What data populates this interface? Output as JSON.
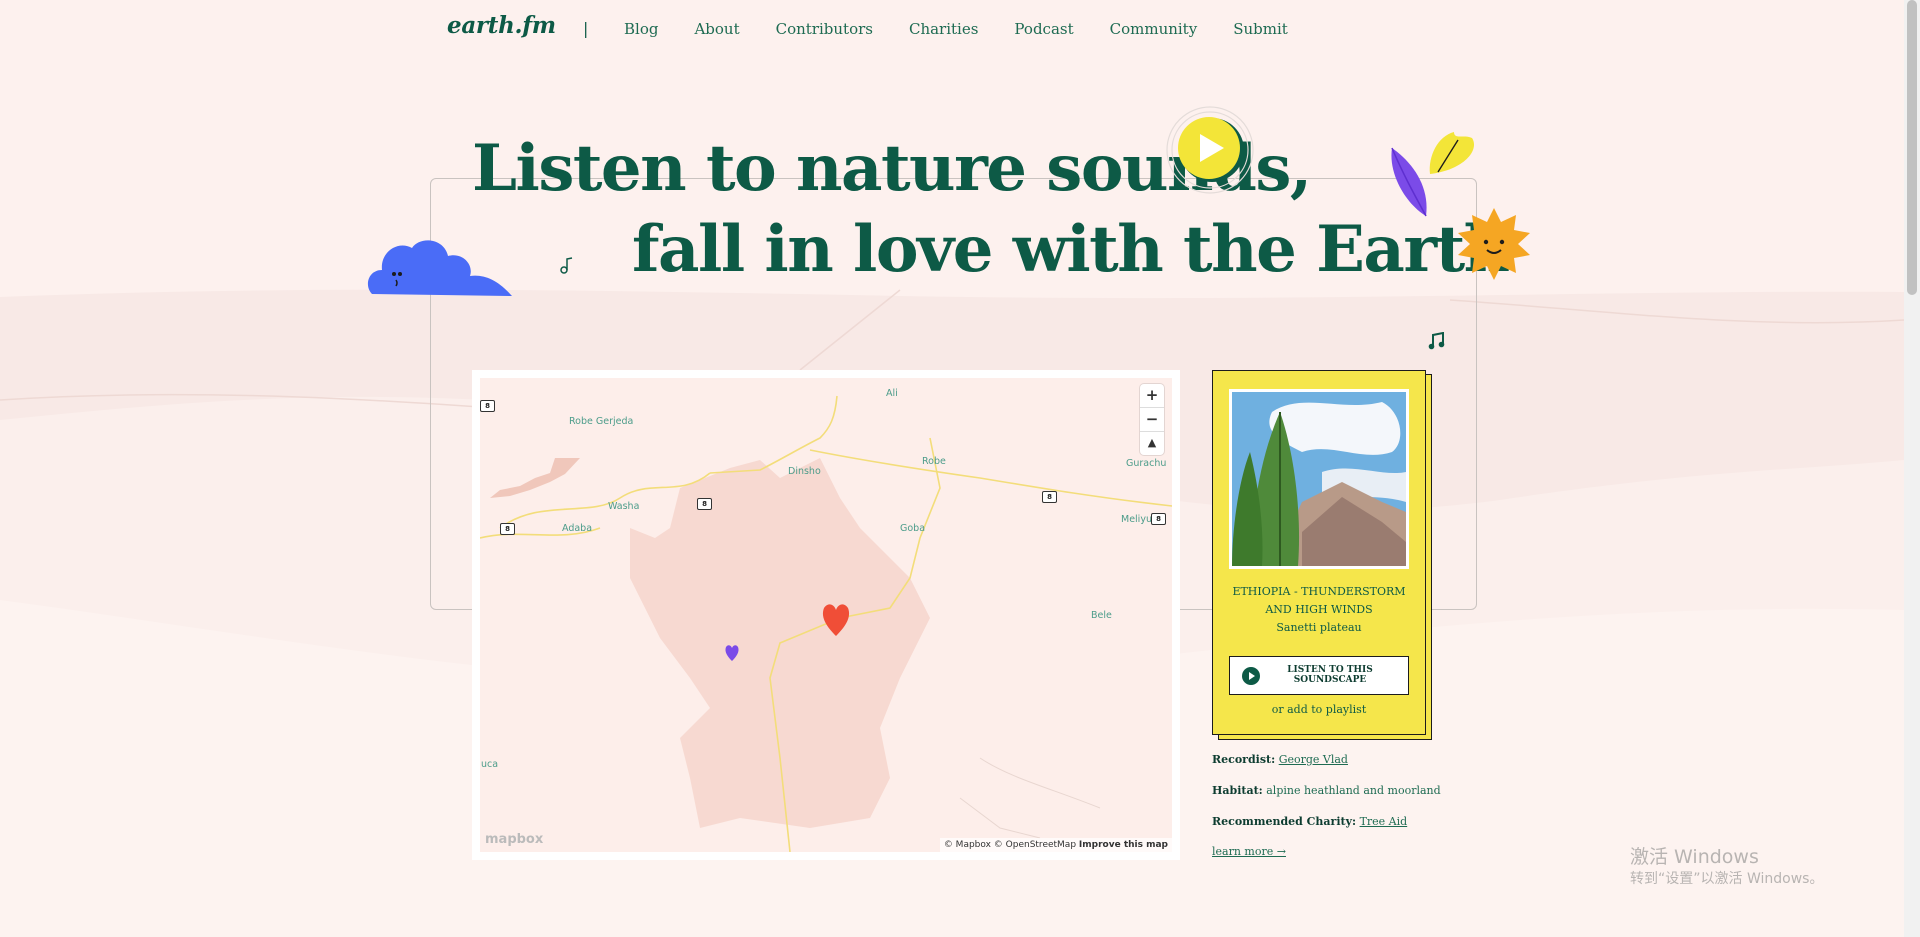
{
  "nav": {
    "logo": "earth.fm",
    "separator": "|",
    "links": [
      "Blog",
      "About",
      "Contributors",
      "Charities",
      "Podcast",
      "Community",
      "Submit"
    ]
  },
  "hero": {
    "line1": "Listen to nature sounds,",
    "line2": "fall in love with the Earth"
  },
  "map": {
    "zoom_in": "+",
    "zoom_out": "−",
    "compass": "▲",
    "towns": [
      "Robe Gerjeda",
      "Ali",
      "Dinsho",
      "Robe",
      "Gurachu",
      "Washa",
      "Adaba",
      "Goba",
      "Meliyu",
      "Bele",
      "uca"
    ],
    "road_shield": "8",
    "mapbox_logo": "mapbox",
    "attribution": "© Mapbox © OpenStreetMap",
    "improve_link": "Improve this map"
  },
  "soundscape": {
    "title": "ETHIOPIA - THUNDERSTORM AND HIGH WINDS",
    "location": "Sanetti plateau",
    "listen_button": "LISTEN TO THIS SOUNDSCAPE",
    "playlist_link": "or add to playlist",
    "recordist_label": "Recordist:",
    "recordist": "George Vlad",
    "habitat_label": "Habitat:",
    "habitat": "alpine heathland and moorland",
    "charity_label": "Recommended Charity:",
    "charity": "Tree Aid",
    "learn_more": "learn more →"
  },
  "os_watermark": {
    "line1": "激活 Windows",
    "line2": "转到“设置”以激活 Windows。"
  }
}
